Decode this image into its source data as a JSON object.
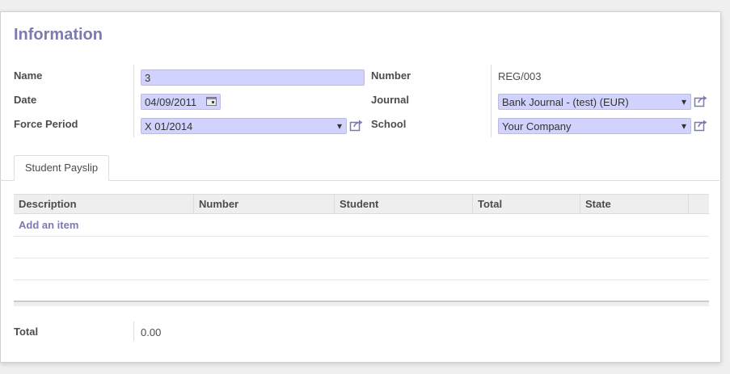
{
  "form": {
    "title": "Information",
    "name_label": "Name",
    "name_value": "3",
    "date_label": "Date",
    "date_value": "04/09/2011",
    "force_period_label": "Force Period",
    "force_period_value": "X 01/2014",
    "number_label": "Number",
    "number_value": "REG/003",
    "journal_label": "Journal",
    "journal_value": "Bank Journal - (test) (EUR)",
    "school_label": "School",
    "school_value": "Your Company"
  },
  "tabs": [
    {
      "label": "Student Payslip"
    }
  ],
  "table": {
    "columns": [
      "Description",
      "Number",
      "Student",
      "Total",
      "State"
    ],
    "add_item": "Add an item"
  },
  "footer": {
    "total_label": "Total",
    "total_value": "0.00"
  },
  "colors": {
    "accent": "#7c7bad",
    "field_bg": "#d2d2ff"
  },
  "icons": {
    "external_link": "external-link-icon",
    "calendar": "calendar-icon",
    "dropdown": "chevron-down-icon"
  }
}
